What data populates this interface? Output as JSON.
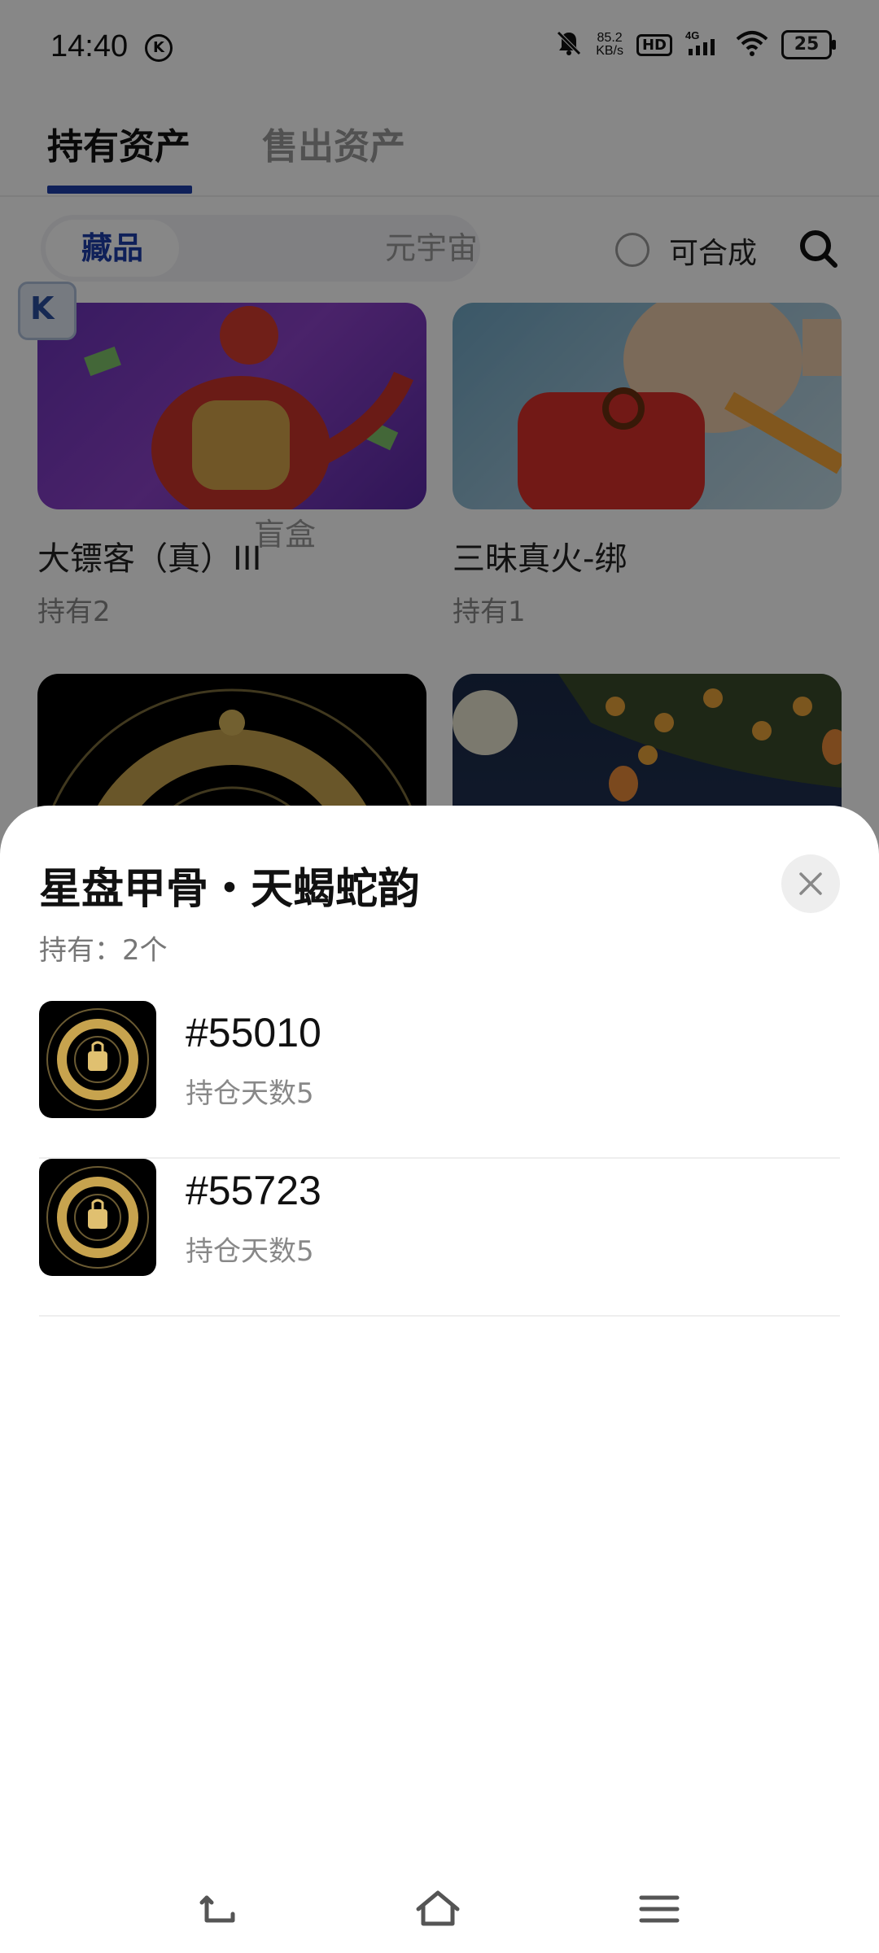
{
  "status": {
    "time": "14:40",
    "net_speed_value": "85.2",
    "net_speed_unit": "KB/s",
    "hd": "HD",
    "network": "4G",
    "battery": "25"
  },
  "tabs": {
    "held": "持有资产",
    "sold": "售出资产"
  },
  "filters": {
    "segments": [
      "藏品",
      "盲盒",
      "元宇宙"
    ],
    "combine_label": "可合成"
  },
  "grid": {
    "cards": [
      {
        "title": "大镖客（真）III",
        "holding": "持有2"
      },
      {
        "title": "三昧真火-绑",
        "holding": "持有1"
      }
    ]
  },
  "sheet": {
    "title": "星盘甲骨・天蝎蛇韵",
    "holding": "持有：2个",
    "items": [
      {
        "id": "#55010",
        "days": "持仓天数5"
      },
      {
        "id": "#55723",
        "days": "持仓天数5"
      }
    ]
  },
  "colors": {
    "accent": "#1e3ea8",
    "overlay": "rgba(0,0,0,0.47)"
  },
  "icons": {
    "close": "close-icon",
    "search": "search-icon",
    "back": "back-icon",
    "home": "home-icon",
    "menu": "menu-icon"
  }
}
